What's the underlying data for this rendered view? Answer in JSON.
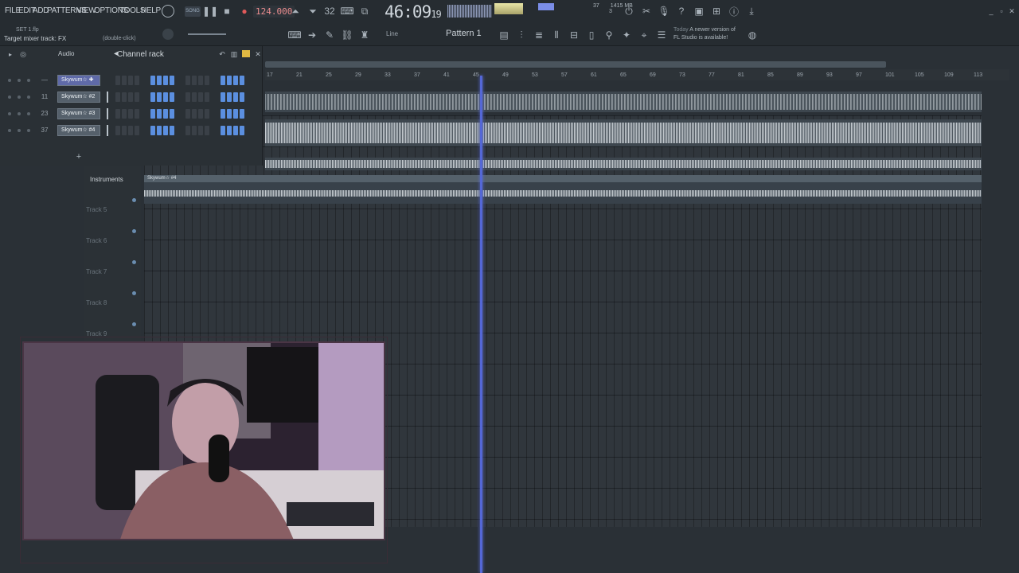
{
  "menu": [
    "FILE",
    "EDIT",
    "ADD",
    "PATTERNS",
    "VIEW",
    "OPTIONS",
    "TOOLS",
    "HELP"
  ],
  "transport": {
    "mode": "SONG",
    "tempo": "124.000",
    "song_time": "46:09",
    "song_time_frac": "19"
  },
  "cpu": {
    "value": "37",
    "memory": "1415 MB",
    "voices": "3"
  },
  "hint": {
    "file": "SET 1.flp",
    "target": "Target mixer track: FX",
    "action": "(double-click)"
  },
  "news": {
    "when": "Today",
    "line1": "A newer version of",
    "line2": "FL Studio is available!"
  },
  "pattern": {
    "name": "Pattern 1",
    "snap": "Line"
  },
  "channel_rack": {
    "title": "Channel rack",
    "filter": "Audio",
    "channels": [
      {
        "num": "—",
        "name": "Skywum☆ ✚"
      },
      {
        "num": "11",
        "name": "Skywum☆ #2"
      },
      {
        "num": "23",
        "name": "Skywum☆ #3"
      },
      {
        "num": "37",
        "name": "Skywum☆ #4"
      }
    ]
  },
  "playlist": {
    "instruments_label": "Instruments",
    "clip_name": "Skywum☆ #4",
    "tracks": [
      "Track 5",
      "Track 6",
      "Track 7",
      "Track 8",
      "Track 9"
    ],
    "ruler": [
      "17",
      "21",
      "25",
      "29",
      "33",
      "37",
      "41",
      "45",
      "49",
      "53",
      "57",
      "61",
      "65",
      "69",
      "73",
      "77",
      "81",
      "85",
      "89",
      "93",
      "97",
      "101",
      "105",
      "109",
      "113"
    ]
  }
}
